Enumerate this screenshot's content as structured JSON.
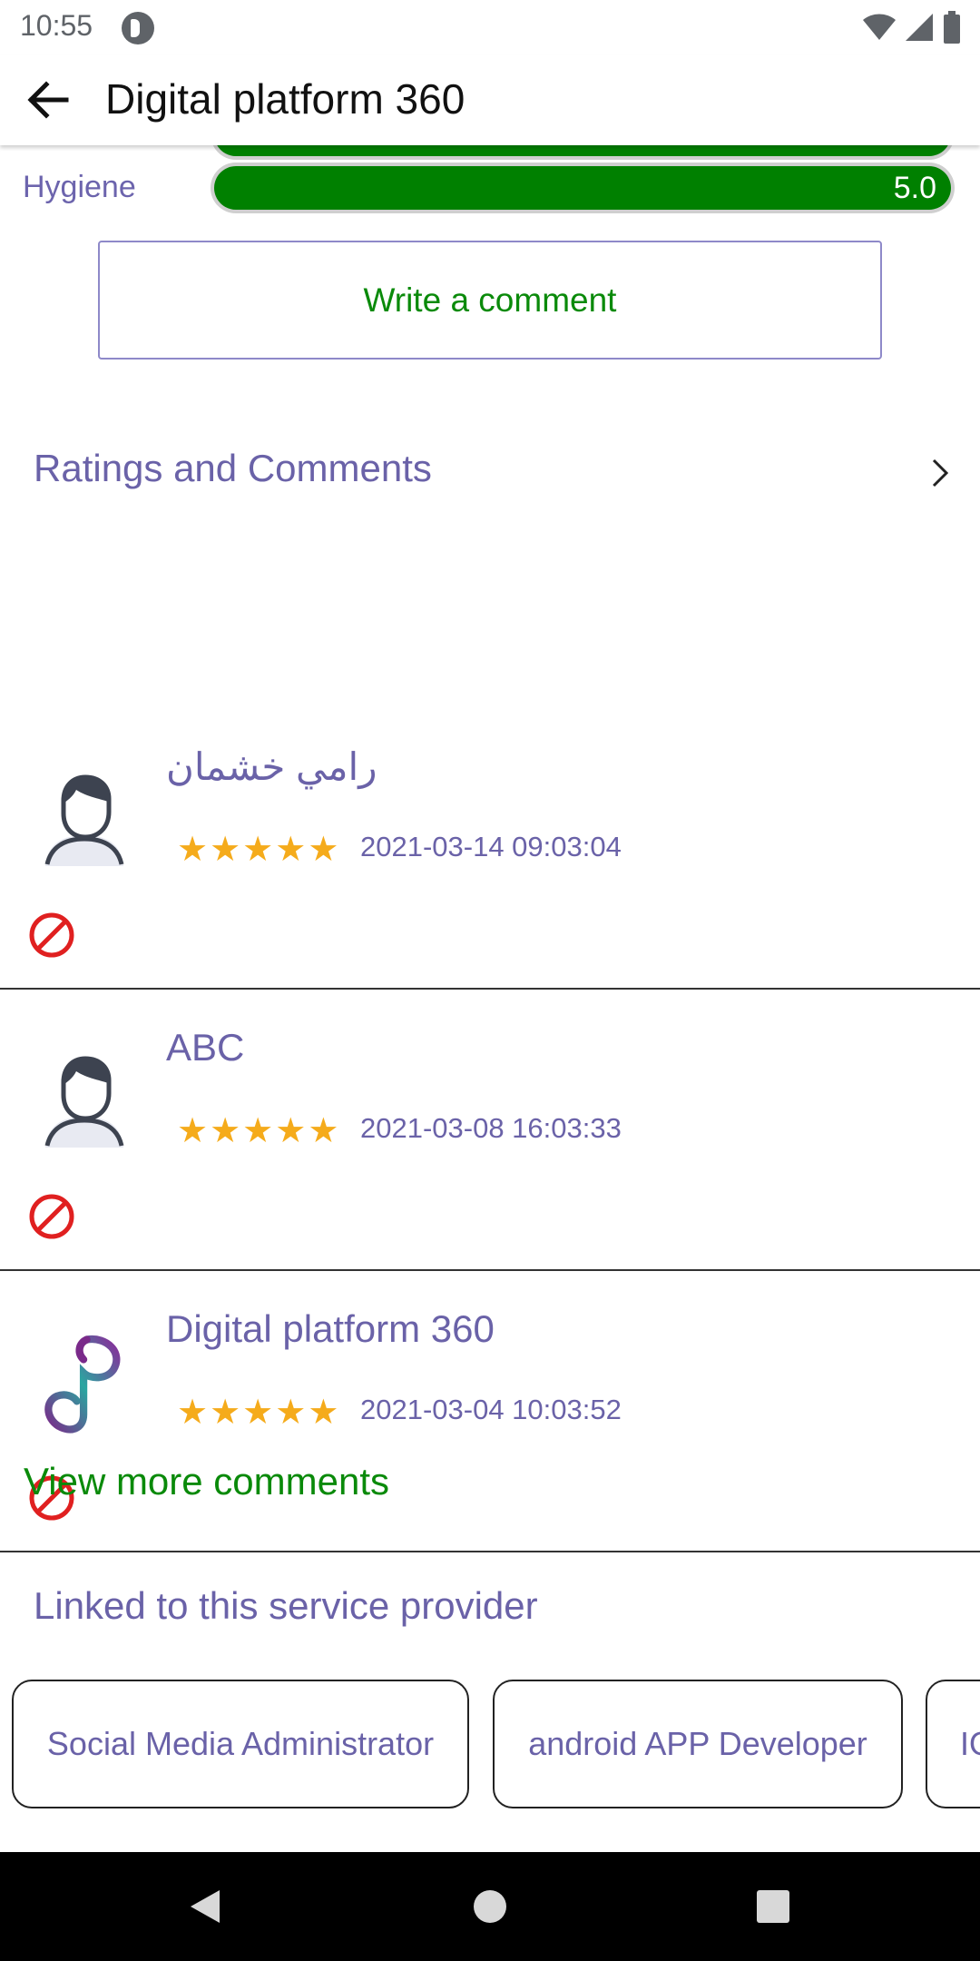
{
  "status_bar": {
    "time": "10:55"
  },
  "app_bar": {
    "title": "Digital platform 360"
  },
  "ratings": [
    {
      "label": "",
      "value": ""
    },
    {
      "label": "Hygiene",
      "value": "5.0"
    }
  ],
  "write_comment_label": "Write a comment",
  "ratings_comments_title": "Ratings and Comments",
  "comments": [
    {
      "name": "رامي خشمان",
      "stars": 5,
      "date": "2021-03-14 09:03:04",
      "avatar": "user-icon"
    },
    {
      "name": "ABC",
      "stars": 5,
      "date": "2021-03-08 16:03:33",
      "avatar": "user-icon"
    },
    {
      "name": "Digital platform 360",
      "stars": 5,
      "date": "2021-03-04 10:03:52",
      "avatar": "platform-logo-icon"
    }
  ],
  "view_more_label": "View more comments",
  "linked_title": "Linked to this service provider",
  "linked_chips": [
    "Social Media Administrator",
    "android APP Developer",
    "IO"
  ],
  "colors": {
    "accent_green": "#008000",
    "text_purple": "#6a62a8",
    "star": "#f5ab1b",
    "report_red": "#e02020"
  }
}
